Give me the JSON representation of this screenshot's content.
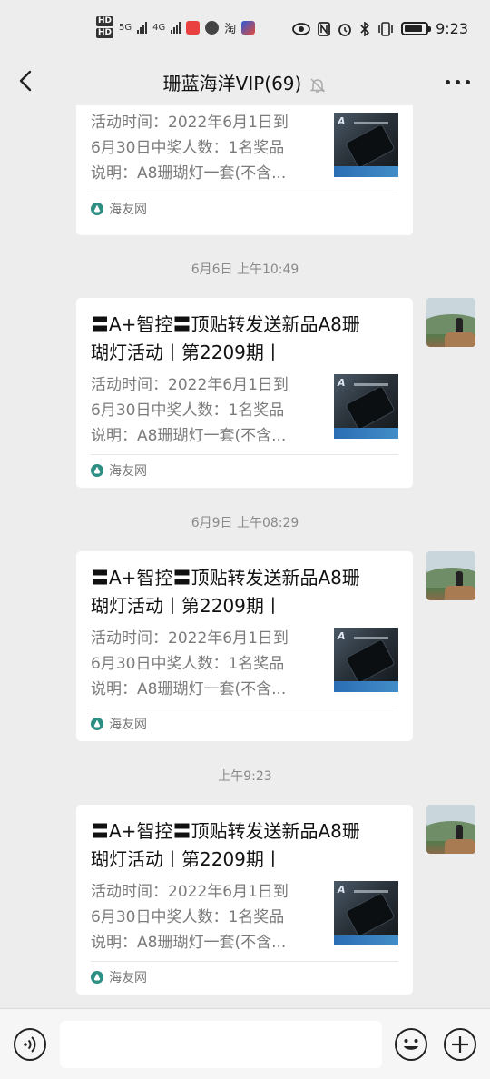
{
  "status_bar": {
    "time": "9:23",
    "network_1": "5G",
    "network_2": "4G",
    "app_icons": [
      "hd-icon",
      "red-app-icon",
      "pinwheel-icon",
      "taobao-icon",
      "mail-icon"
    ],
    "app_label_taobao": "淘",
    "battery_level": 0.85
  },
  "header": {
    "title": "珊蓝海洋VIP(69)",
    "muted": true
  },
  "messages": [
    {
      "partial": true,
      "title": "",
      "desc": [
        "活动时间：2022年6月1日到",
        "6月30日中奖人数：1名奖品",
        "说明：A8珊瑚灯一套(不含..."
      ],
      "source": "海友网"
    },
    {
      "time": "6月6日 上午10:49",
      "title": "〓A+智控〓顶贴转发送新品A8珊瑚灯活动丨第2209期丨",
      "title_line1": "〓A+智控〓顶贴转发送新品A8珊",
      "title_line2": "瑚灯活动丨第2209期丨",
      "desc": [
        "活动时间：2022年6月1日到",
        "6月30日中奖人数：1名奖品",
        "说明：A8珊瑚灯一套(不含..."
      ],
      "source": "海友网"
    },
    {
      "time": "6月9日 上午08:29",
      "title_line1": "〓A+智控〓顶贴转发送新品A8珊",
      "title_line2": "瑚灯活动丨第2209期丨",
      "desc": [
        "活动时间：2022年6月1日到",
        "6月30日中奖人数：1名奖品",
        "说明：A8珊瑚灯一套(不含..."
      ],
      "source": "海友网"
    },
    {
      "time": "上午9:23",
      "title_line1": "〓A+智控〓顶贴转发送新品A8珊",
      "title_line2": "瑚灯活动丨第2209期丨",
      "desc": [
        "活动时间：2022年6月1日到",
        "6月30日中奖人数：1名奖品",
        "说明：A8珊瑚灯一套(不含..."
      ],
      "source": "海友网"
    }
  ],
  "input_bar": {
    "placeholder": "",
    "value": ""
  },
  "colors": {
    "background": "#ededed",
    "card": "#ffffff",
    "meta_text": "#8a8a8a",
    "source_icon": "#2d8f84"
  }
}
